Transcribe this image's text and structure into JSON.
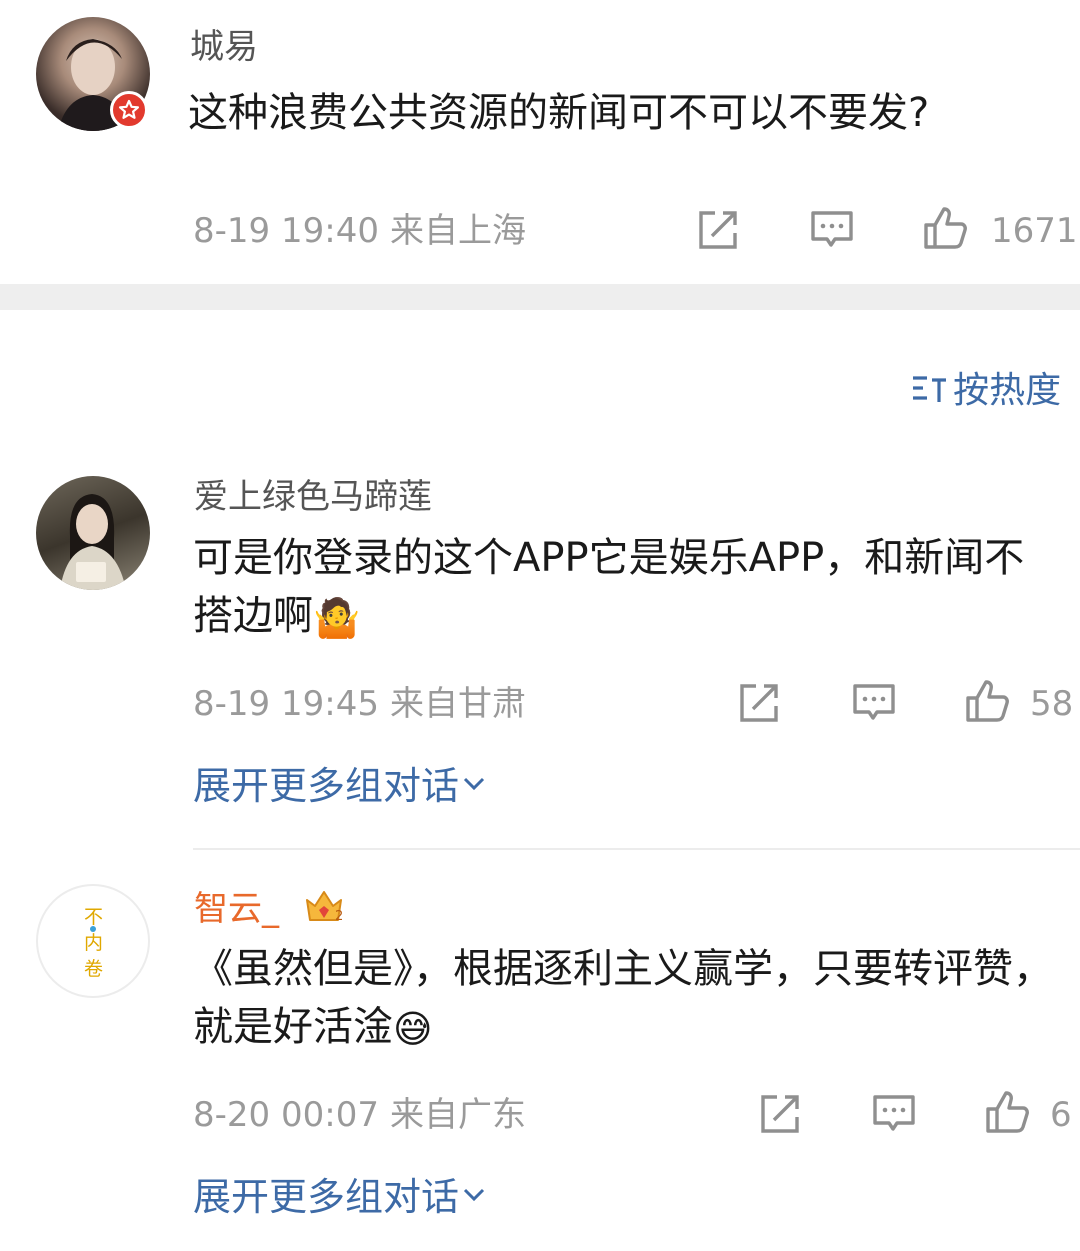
{
  "comments": [
    {
      "username": "城易",
      "text": "这种浪费公共资源的新闻可不可以不要发?",
      "time": "8-19 19:40",
      "location": "来自上海",
      "likes": "1671",
      "avatar_icon": "portrait-avatar",
      "badge_icon": "verified-star-badge-icon"
    },
    {
      "username": "爱上绿色马蹄莲",
      "text": "可是你登录的这个APP它是娱乐APP，和新闻不搭边啊",
      "emoji": "🤷",
      "time": "8-19 19:45",
      "location": "来自甘肃",
      "likes": "58",
      "expand_label": "展开更多组对话"
    },
    {
      "username": "智云_",
      "username_color": "#e8692b",
      "text": "《虽然但是》，根据逐利主义赢学，只要转评赞，就是好活淦",
      "emoji": "😅",
      "time": "8-20 00:07",
      "location": "来自广东",
      "likes": "6",
      "avatar_text": [
        "不",
        "内",
        "卷"
      ],
      "badge_icon": "crown-badge-icon",
      "expand_label": "展开更多组对话"
    }
  ],
  "sort": {
    "label": "按热度",
    "icon": "sort-icon"
  },
  "colors": {
    "link": "#3d6aa6",
    "meta": "#9a9a9a",
    "divider_band": "#eeeeee"
  }
}
